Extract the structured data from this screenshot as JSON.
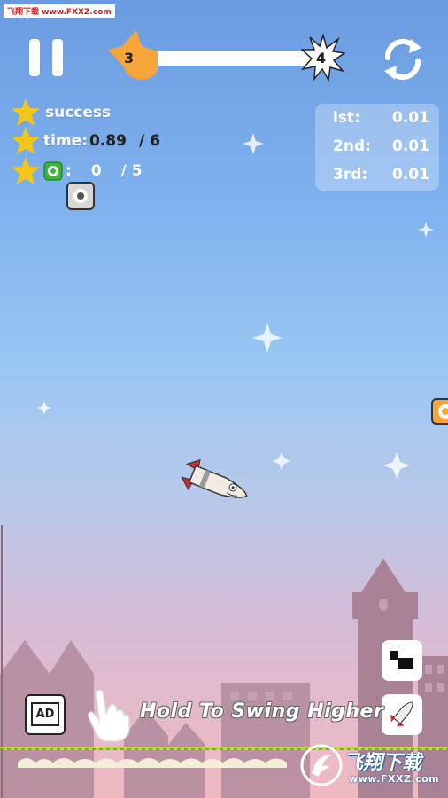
{
  "watermark_top": "飞翔下载 www.FXXZ.com",
  "level": {
    "current": "3",
    "next": "4"
  },
  "objectives": {
    "success_label": "success",
    "time_label": "time:",
    "time_value": "0.89",
    "time_target": "/ 6",
    "collect_label": ":",
    "collect_value": "0",
    "collect_target": "/ 5"
  },
  "records": [
    {
      "rank": "lst:",
      "value": "0.01"
    },
    {
      "rank": "2nd:",
      "value": "0.01"
    },
    {
      "rank": "3rd:",
      "value": "0.01"
    }
  ],
  "hint_text": "Hold To Swing Higher",
  "ad_label": "AD",
  "watermark_bottom": {
    "cn": "飞翔下载",
    "url": "www.FXXZ.com"
  },
  "colors": {
    "star": "#f4c619",
    "level_flame": "#f5a53a",
    "token_green": "#3cb43c",
    "ring_orange": "#f5a53a",
    "rocket_red": "#c92d2d"
  },
  "icons": [
    "pause-icon",
    "restart-icon",
    "star-icon",
    "token-icon",
    "ring-icon",
    "hand-pointer-icon",
    "stamp-icon",
    "rocket-icon",
    "ad-icon"
  ]
}
